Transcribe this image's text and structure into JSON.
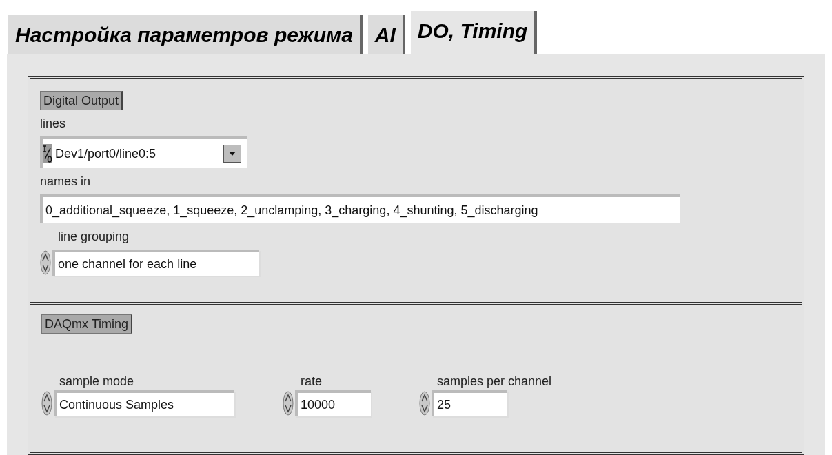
{
  "tabs": [
    {
      "label": "Настройка параметров режима",
      "selected": false
    },
    {
      "label": "AI",
      "selected": false
    },
    {
      "label": "DO, Timing",
      "selected": true
    }
  ],
  "digital_output": {
    "title": "Digital Output",
    "lines": {
      "label": "lines",
      "value": "Dev1/port0/line0:5"
    },
    "names_in": {
      "label": "names in",
      "value": "0_additional_squeeze, 1_squeeze, 2_unclamping, 3_charging, 4_shunting, 5_discharging"
    },
    "line_grouping": {
      "label": "line grouping",
      "value": "one channel for each line"
    }
  },
  "daqmx_timing": {
    "title": "DAQmx Timing",
    "controls": [
      {
        "label": "sample mode",
        "value": "Continuous Samples"
      },
      {
        "label": "rate",
        "value": "10000"
      },
      {
        "label": "samples per channel",
        "value": "25"
      }
    ]
  }
}
